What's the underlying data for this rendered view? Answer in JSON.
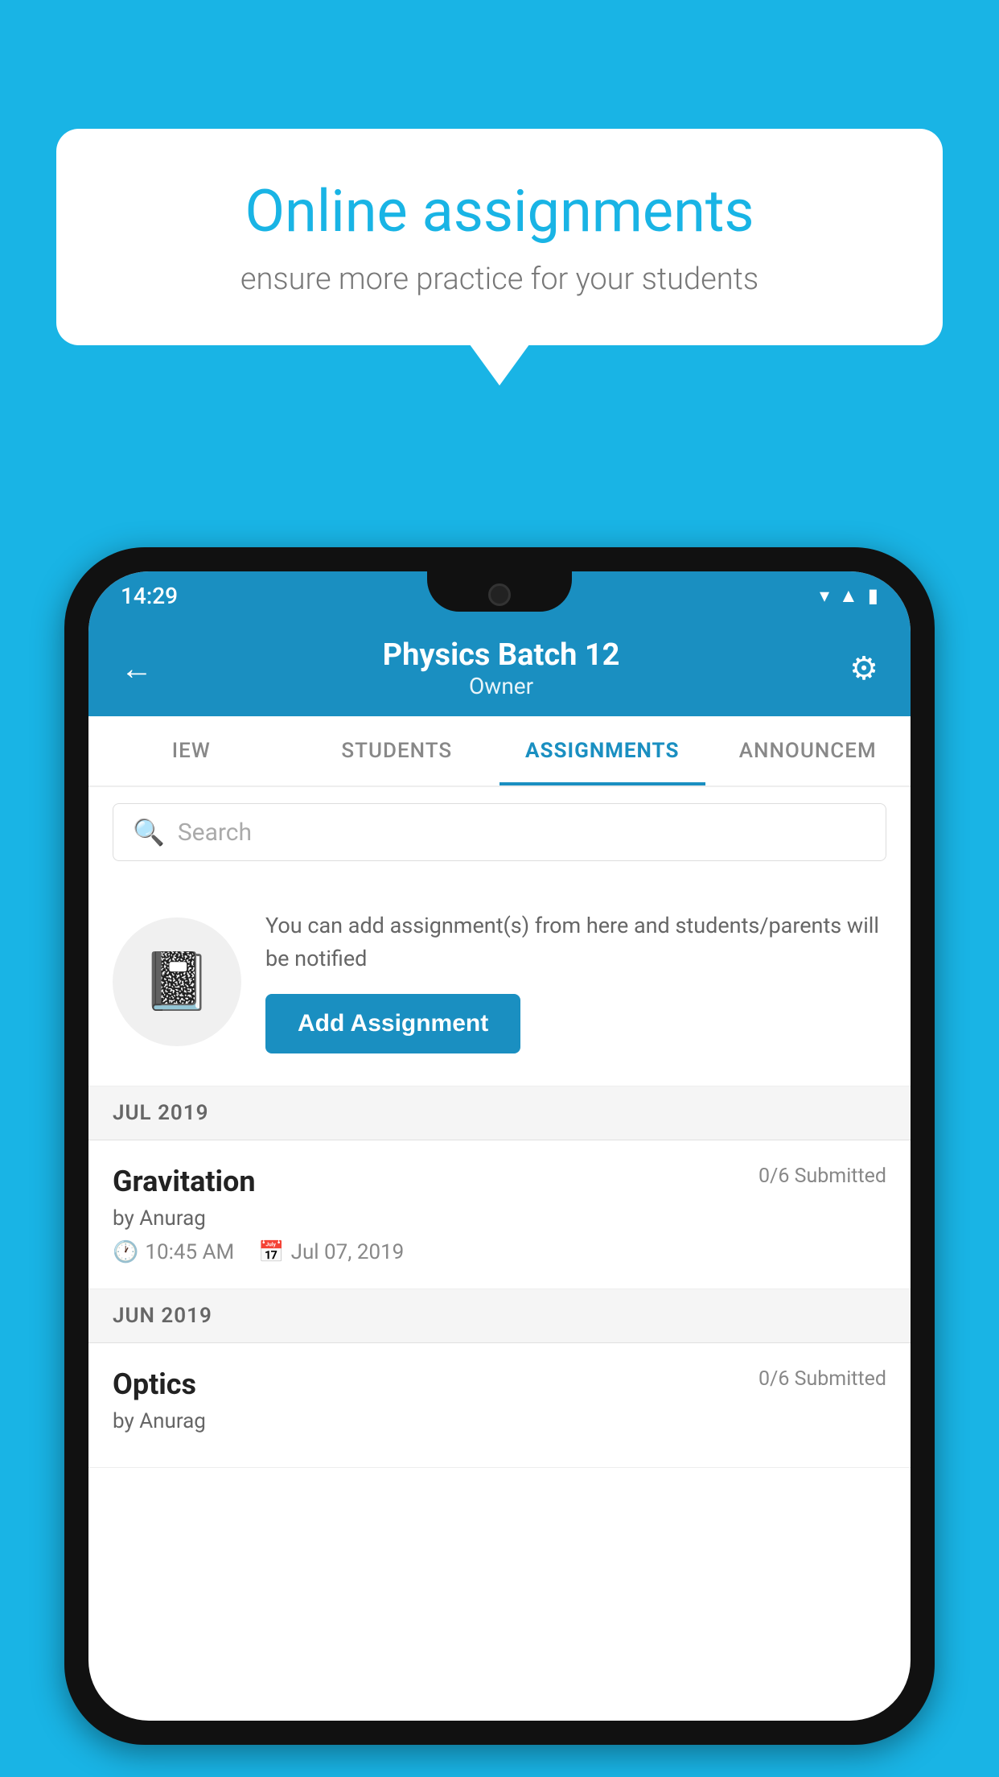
{
  "background_color": "#19b4e5",
  "speech_bubble": {
    "title": "Online assignments",
    "subtitle": "ensure more practice for your students"
  },
  "status_bar": {
    "time": "14:29",
    "icons": [
      "wifi",
      "signal",
      "battery"
    ]
  },
  "app_bar": {
    "title": "Physics Batch 12",
    "subtitle": "Owner",
    "back_icon": "←",
    "settings_icon": "⚙"
  },
  "tabs": [
    {
      "label": "IEW",
      "active": false
    },
    {
      "label": "STUDENTS",
      "active": false
    },
    {
      "label": "ASSIGNMENTS",
      "active": true
    },
    {
      "label": "ANNOUNCEM",
      "active": false
    }
  ],
  "search": {
    "placeholder": "Search"
  },
  "promo": {
    "text": "You can add assignment(s) from here and students/parents will be notified",
    "button_label": "Add Assignment"
  },
  "sections": [
    {
      "header": "JUL 2019",
      "assignments": [
        {
          "title": "Gravitation",
          "submitted": "0/6 Submitted",
          "author": "by Anurag",
          "time": "10:45 AM",
          "date": "Jul 07, 2019"
        }
      ]
    },
    {
      "header": "JUN 2019",
      "assignments": [
        {
          "title": "Optics",
          "submitted": "0/6 Submitted",
          "author": "by Anurag",
          "time": "",
          "date": ""
        }
      ]
    }
  ]
}
